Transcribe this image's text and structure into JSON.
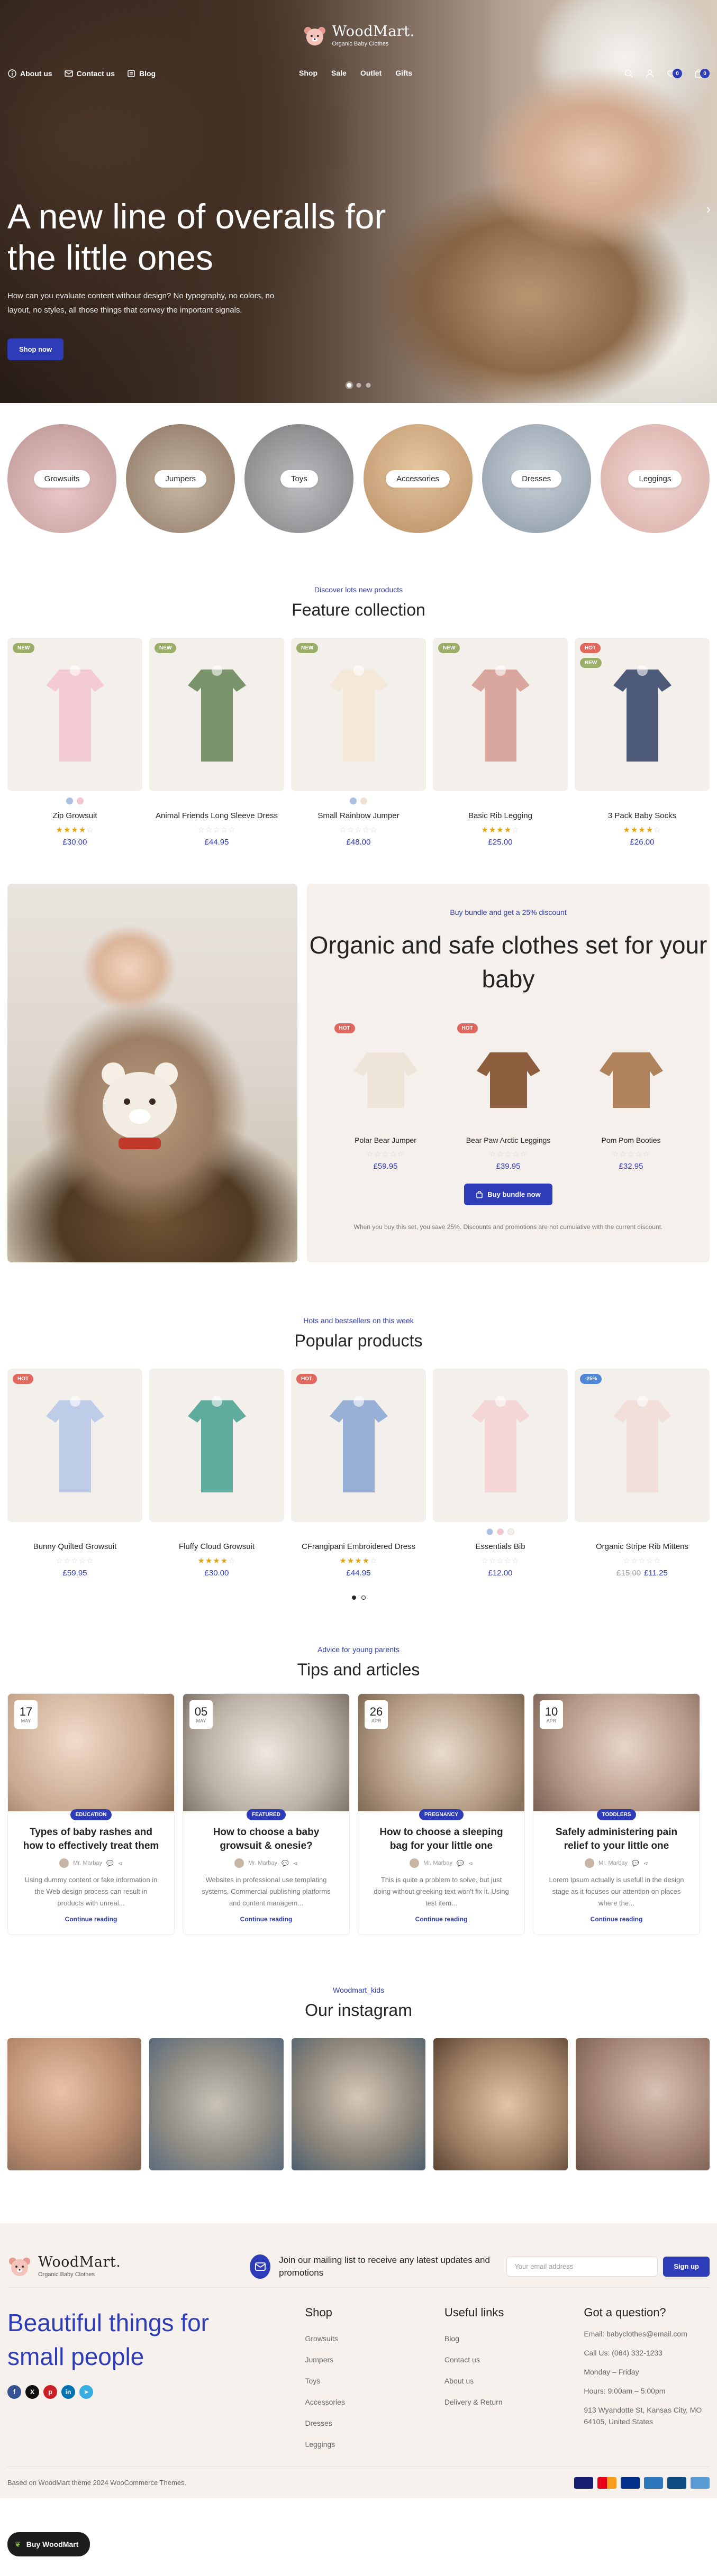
{
  "brand": {
    "name": "WoodMart.",
    "tagline": "Organic Baby Clothes"
  },
  "header": {
    "left": [
      {
        "label": "About us",
        "icon": "info-icon"
      },
      {
        "label": "Contact us",
        "icon": "mail-icon"
      },
      {
        "label": "Blog",
        "icon": "blog-icon"
      }
    ],
    "center": [
      "Shop",
      "Sale",
      "Outlet",
      "Gifts"
    ],
    "wishlist_count": "0",
    "cart_count": "0"
  },
  "hero": {
    "title": "A new line of overalls for the little ones",
    "subtitle": "How can you evaluate content without design? No typography, no colors, no layout, no styles, all those things that convey the important signals.",
    "button": "Shop now"
  },
  "categories": [
    "Growsuits",
    "Jumpers",
    "Toys",
    "Accessories",
    "Dresses",
    "Leggings"
  ],
  "feature": {
    "kicker": "Discover lots new products",
    "title": "Feature collection",
    "products": [
      {
        "name": "Zip Growsuit",
        "price": "£30.00",
        "rating": 4,
        "labels": [
          "new"
        ],
        "swatches": [
          "#a9c0e3",
          "#f2c5cf"
        ]
      },
      {
        "name": "Animal Friends Long Sleeve Dress",
        "price": "£44.95",
        "rating": 0,
        "labels": [
          "new"
        ],
        "swatches": []
      },
      {
        "name": "Small Rainbow Jumper",
        "price": "£48.00",
        "rating": 0,
        "labels": [
          "new"
        ],
        "swatches": [
          "#a9c0e3",
          "#efe2d3"
        ]
      },
      {
        "name": "Basic Rib Legging",
        "price": "£25.00",
        "rating": 4,
        "labels": [
          "new"
        ],
        "swatches": []
      },
      {
        "name": "3 Pack Baby Socks",
        "price": "£26.00",
        "rating": 4,
        "labels": [
          "hot",
          "new"
        ],
        "swatches": []
      }
    ]
  },
  "bundle": {
    "kicker": "Buy bundle and get a 25% discount",
    "title": "Organic and safe clothes set for your baby",
    "products": [
      {
        "name": "Polar Bear Jumper",
        "price": "£59.95",
        "label": "hot"
      },
      {
        "name": "Bear Paw Arctic Leggings",
        "price": "£39.95",
        "label": "hot"
      },
      {
        "name": "Pom Pom Booties",
        "price": "£32.95",
        "label": ""
      }
    ],
    "button": "Buy bundle now",
    "note": "When you buy this set, you save 25%. Discounts and promotions are not cumulative with the current discount."
  },
  "popular": {
    "kicker": "Hots and bestsellers on this week",
    "title": "Popular products",
    "products": [
      {
        "name": "Bunny Quilted Growsuit",
        "price": "£59.95",
        "old_price": "",
        "rating": 0,
        "label": "hot",
        "swatches": []
      },
      {
        "name": "Fluffy Cloud Growsuit",
        "price": "£30.00",
        "old_price": "",
        "rating": 4,
        "label": "",
        "swatches": []
      },
      {
        "name": "CFrangipani Embroidered Dress",
        "price": "£44.95",
        "old_price": "",
        "rating": 4,
        "label": "hot",
        "swatches": []
      },
      {
        "name": "Essentials Bib",
        "price": "£12.00",
        "old_price": "",
        "rating": 0,
        "label": "",
        "swatches": [
          "#a9c0e3",
          "#f2c5cf",
          "#f4efea"
        ]
      },
      {
        "name": "Organic Stripe Rib Mittens",
        "price": "£11.25",
        "old_price": "£15.00",
        "rating": 0,
        "label": "-25%",
        "swatches": []
      }
    ]
  },
  "blog": {
    "kicker": "Advice for young parents",
    "title": "Tips and articles",
    "posts": [
      {
        "day": "17",
        "month": "May",
        "category": "Education",
        "title": "Types of baby rashes and how to effectively treat them",
        "author": "Mr. Marbay",
        "excerpt": "Using dummy content or fake information in the Web design process can result in products with unreal...",
        "more": "Continue reading"
      },
      {
        "day": "05",
        "month": "May",
        "category": "Featured",
        "title": "How to choose a baby growsuit & onesie?",
        "author": "Mr. Marbay",
        "excerpt": "Websites in professional use templating systems. Commercial publishing platforms and content managem...",
        "more": "Continue reading"
      },
      {
        "day": "26",
        "month": "Apr",
        "category": "Pregnancy",
        "title": "How to choose a sleeping bag for your little one",
        "author": "Mr. Marbay",
        "excerpt": "This is quite a problem to solve, but just doing without greeking text won't fix it. Using test item...",
        "more": "Continue reading"
      },
      {
        "day": "10",
        "month": "Apr",
        "category": "Toddlers",
        "title": "Safely administering pain relief to your little one",
        "author": "Mr. Marbay",
        "excerpt": "Lorem Ipsum actually is usefull in the design stage as it focuses our attention on places where the...",
        "more": "Continue reading"
      }
    ]
  },
  "instagram": {
    "kicker": "Woodmart_kids",
    "title": "Our instagram"
  },
  "footer": {
    "newsletter": "Join our mailing list to receive any latest updates and promotions",
    "email_placeholder": "Your email address",
    "sign_up": "Sign up",
    "slogan": "Beautiful things for small people",
    "shop": {
      "title": "Shop",
      "links": [
        "Growsuits",
        "Jumpers",
        "Toys",
        "Accessories",
        "Dresses",
        "Leggings"
      ]
    },
    "useful": {
      "title": "Useful links",
      "links": [
        "Blog",
        "Contact us",
        "About us",
        "Delivery & Return"
      ]
    },
    "question": {
      "title": "Got a question?",
      "lines": [
        "Email: babyclothes@email.com",
        "Call Us: (064) 332-1233",
        "Monday – Friday",
        "Hours: 9:00am – 5:00pm",
        "913 Wyandotte St, Kansas City, MO 64105, United States"
      ]
    },
    "copyright": "Based on WoodMart theme 2024 WooCommerce Themes."
  },
  "buy_badge": "Buy WoodMart",
  "colors": {
    "accent": "#2f3cb8",
    "new": "#9aae6a",
    "hot": "#e1685f",
    "sale": "#4f87d6",
    "footer_bg": "#f6f1ec"
  }
}
